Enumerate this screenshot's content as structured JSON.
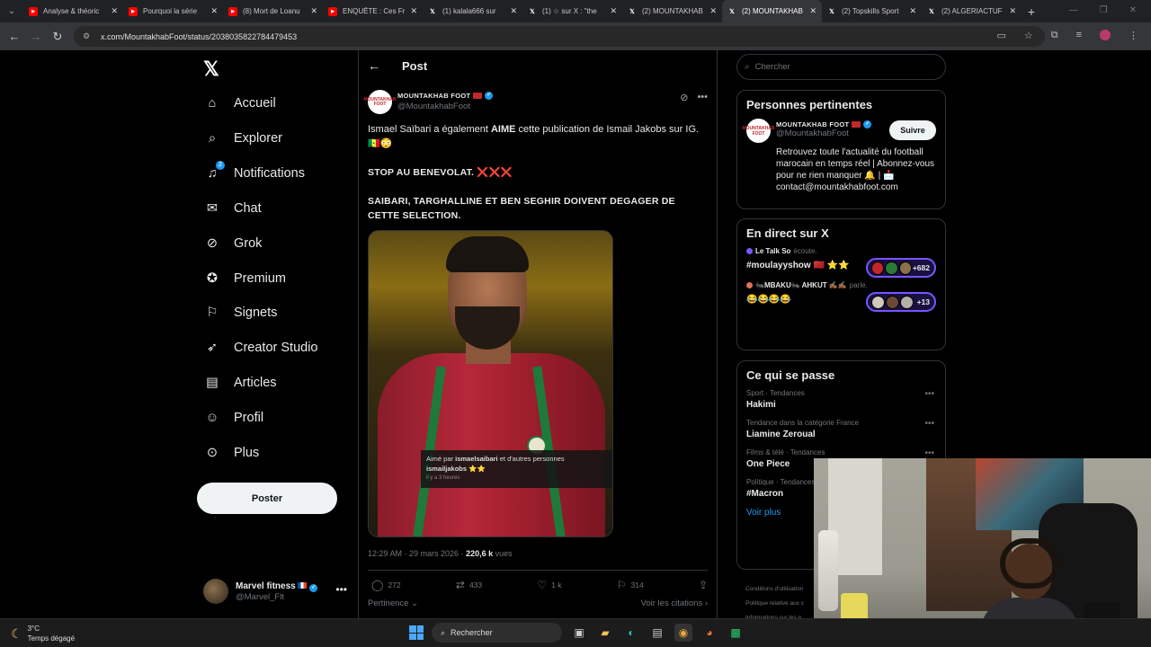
{
  "browser": {
    "tabs": [
      {
        "title": "Analyse & théoric",
        "kind": "yt",
        "active": false
      },
      {
        "title": "Pourquoi la série",
        "kind": "yt",
        "active": false
      },
      {
        "title": "(8) Mort de Loanu",
        "kind": "yt",
        "active": false
      },
      {
        "title": "ENQUÊTE : Ces Fr",
        "kind": "yt",
        "active": false
      },
      {
        "title": "(1) kalala666 sur",
        "kind": "x",
        "active": false
      },
      {
        "title": "(1) ☆ sur X : \"the",
        "kind": "x",
        "active": false
      },
      {
        "title": "(2) MOUNTAKHAB",
        "kind": "x",
        "active": false
      },
      {
        "title": "(2) MOUNTAKHAB",
        "kind": "x",
        "active": true
      },
      {
        "title": "(2) Topskills Sport",
        "kind": "x",
        "active": false
      },
      {
        "title": "(2) ALGERIACTUF",
        "kind": "x",
        "active": false
      }
    ],
    "url": "x.com/MountakhabFoot/status/2038035822784479453"
  },
  "nav": {
    "items": [
      {
        "label": "Accueil",
        "icon": "home-icon"
      },
      {
        "label": "Explorer",
        "icon": "search-icon"
      },
      {
        "label": "Notifications",
        "icon": "bell-icon",
        "badge": "2"
      },
      {
        "label": "Chat",
        "icon": "mail-icon"
      },
      {
        "label": "Grok",
        "icon": "grok-icon"
      },
      {
        "label": "Premium",
        "icon": "premium-icon"
      },
      {
        "label": "Signets",
        "icon": "bookmark-icon"
      },
      {
        "label": "Creator Studio",
        "icon": "rocket-icon"
      },
      {
        "label": "Articles",
        "icon": "article-icon"
      },
      {
        "label": "Profil",
        "icon": "person-icon"
      },
      {
        "label": "Plus",
        "icon": "more-circle-icon"
      }
    ],
    "post_button": "Poster",
    "account": {
      "name": "Marvel fitness",
      "handle": "@Marvel_Flt"
    }
  },
  "post": {
    "header_title": "Post",
    "author_name": "MOUNTAKHAB FOOT",
    "author_handle": "@MountakhabFoot",
    "logo_text": "MOUNTAKHAB FOOT",
    "text1_a": "Ismael Saïbari a également ",
    "text1_bold": "AIME",
    "text1_b": " cette publication de Ismail Jakobs sur IG. 🇸🇳😳",
    "text2": "STOP AU BENEVOLAT. ❌❌❌",
    "text3": "SAIBARI, TARGHALLINE ET BEN SEGHIR DOIVENT DEGAGER DE CETTE SELECTION.",
    "ig_overlay": {
      "liked_by_prefix": "Aimé par ",
      "liked_by_user": "ismaelsaibari",
      "liked_by_suffix": " et d'autres personnes",
      "caption_user": "ismailjakobs",
      "caption_text": " ⭐⭐",
      "time": "il y a 3 heures"
    },
    "time": "12:29 AM · 29 mars 2026 · ",
    "views_count": "220,6 k",
    "views_label": " vues",
    "stats": {
      "replies": "272",
      "reposts": "433",
      "likes": "1 k",
      "bookmarks": "314"
    },
    "relevance": "Pertinence ⌄",
    "quotes": "Voir les citations ›"
  },
  "sidebar": {
    "search_placeholder": "Chercher",
    "relevant": {
      "title": "Personnes pertinentes",
      "name": "MOUNTAKHAB FOOT",
      "handle": "@MountakhabFoot",
      "follow": "Suivre",
      "bio": "Retrouvez toute l'actualité du football marocain en temps réel | Abonnez-vous pour ne rien manquer 🔔 | 📩 contact@mountakhabfoot.com"
    },
    "live": {
      "title": "En direct sur X",
      "spaces": [
        {
          "host": "Le Talk So",
          "status": "écoute.",
          "title": "#moulayyshow 🇲🇦 ⭐⭐",
          "count": "+682"
        },
        {
          "host": "🐜MBAKU🐜 AHKUT ✍🏾✍🏾",
          "status": "parle.",
          "title": "😂😂😂😂",
          "count": "+13"
        }
      ]
    },
    "happening": {
      "title": "Ce qui se passe",
      "trends": [
        {
          "category": "Sport · Tendances",
          "name": "Hakimi"
        },
        {
          "category": "Tendance dans la catégorie France",
          "name": "Liamine Zeroual"
        },
        {
          "category": "Films & télé · Tendances",
          "name": "One Piece"
        },
        {
          "category": "Politique · Tendances",
          "name": "#Macron"
        }
      ],
      "more": "Voir plus"
    },
    "footer": [
      "Conditions d'utilisation",
      "Politique relative aux c",
      "Informations sur les p"
    ]
  },
  "taskbar": {
    "temp": "3°C",
    "weather": "Temps dégagé",
    "search": "Rechercher"
  },
  "colors": {
    "accent": "#1d9bf0",
    "background": "#000000",
    "morocco_red": "#c1272d",
    "spaces_purple": "#7856ff"
  }
}
